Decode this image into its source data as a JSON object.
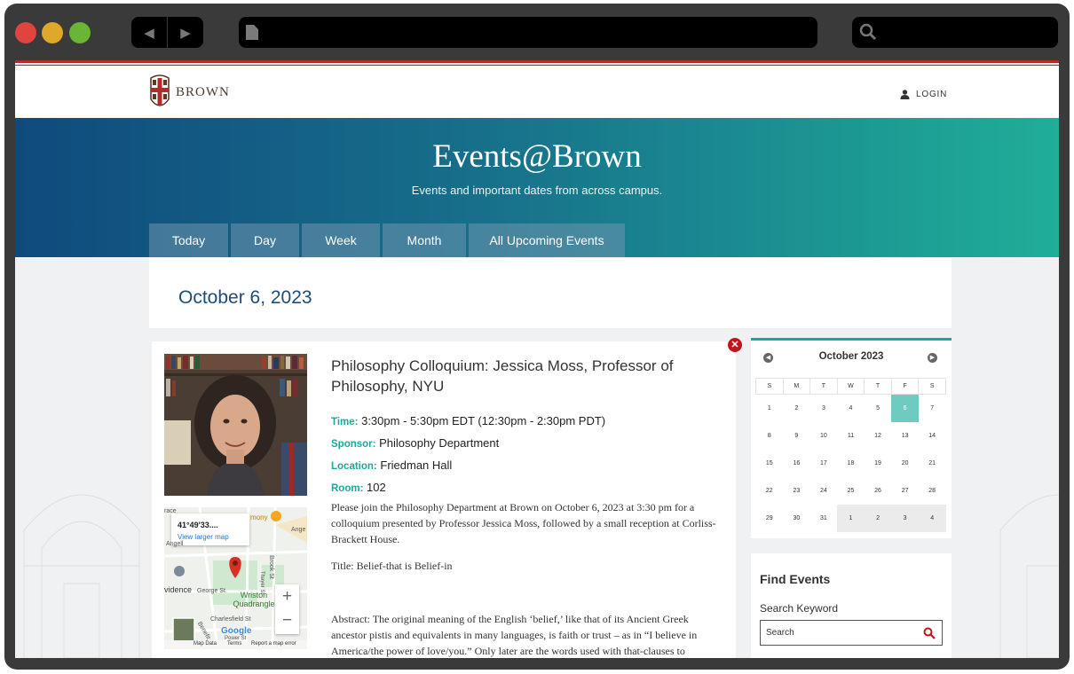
{
  "browser": {
    "back_icon": "◀",
    "forward_icon": "▶"
  },
  "header": {
    "logo_text": "BROWN",
    "login_label": "LOGIN"
  },
  "hero": {
    "title": "Events@Brown",
    "subtitle": "Events and important dates from across campus."
  },
  "tabs": [
    {
      "label": "Today"
    },
    {
      "label": "Day"
    },
    {
      "label": "Week"
    },
    {
      "label": "Month"
    },
    {
      "label": "All Upcoming Events"
    }
  ],
  "date_heading": "October 6, 2023",
  "event": {
    "title": "Philosophy Colloquium: Jessica Moss, Professor of Philosophy, NYU",
    "time_label": "Time:",
    "time_value": "3:30pm - 5:30pm EDT (12:30pm - 2:30pm PDT)",
    "sponsor_label": "Sponsor:",
    "sponsor_value": "Philosophy Department",
    "location_label": "Location:",
    "location_value": "Friedman Hall",
    "room_label": "Room:",
    "room_value": "102",
    "body_1": "Please join the Philosophy Department at Brown on October 6, 2023 at 3:30 pm for a colloquium presented by Professor Jessica Moss, followed by a small reception at Corliss-Brackett House.",
    "body_2": "Title: Belief-that is Belief-in",
    "body_3": "Abstract: The original meaning of the English ‘belief,’ like that of its Ancient Greek ancestor pistis and equivalents in many languages, is faith or trust – as in “I believe in America/the power of love/you.” Only later are the words used with that-clauses to"
  },
  "map": {
    "coords": "41°49'33....",
    "view_larger": "View larger map",
    "label_quad": "Wriston Quadrangle",
    "label_providence": "vidence",
    "label_george": "George St",
    "label_brook": "Brook St",
    "label_thayer": "Thayer St",
    "label_charlesfield": "Charlesfield St",
    "label_benefit": "Benefit",
    "label_angell": "Angell",
    "label_angell2": "Ange",
    "label_mony": "mony",
    "label_race": "race",
    "label_power": "Power St",
    "zoom_in": "+",
    "zoom_out": "−",
    "google": "Google",
    "footer_data": "Map Data",
    "footer_terms": "Terms",
    "footer_report": "Report a map error"
  },
  "calendar": {
    "month_label": "October 2023",
    "prev_icon": "◀",
    "next_icon": "▶",
    "weekdays": [
      "S",
      "M",
      "T",
      "W",
      "T",
      "F",
      "S"
    ],
    "weeks": [
      [
        "1",
        "2",
        "3",
        "4",
        "5",
        "6",
        "7"
      ],
      [
        "8",
        "9",
        "10",
        "11",
        "12",
        "13",
        "14"
      ],
      [
        "15",
        "16",
        "17",
        "18",
        "19",
        "20",
        "21"
      ],
      [
        "22",
        "23",
        "24",
        "25",
        "26",
        "27",
        "28"
      ],
      [
        "29",
        "30",
        "31",
        "1",
        "2",
        "3",
        "4"
      ]
    ],
    "selected_day": "6"
  },
  "find": {
    "title": "Find Events",
    "keyword_label": "Search Keyword",
    "search_placeholder": "Search"
  },
  "colors": {
    "brown_red": "#b12b2b",
    "teal": "#19a99a",
    "navy": "#1b4d7c",
    "close_red": "#c4141b"
  }
}
